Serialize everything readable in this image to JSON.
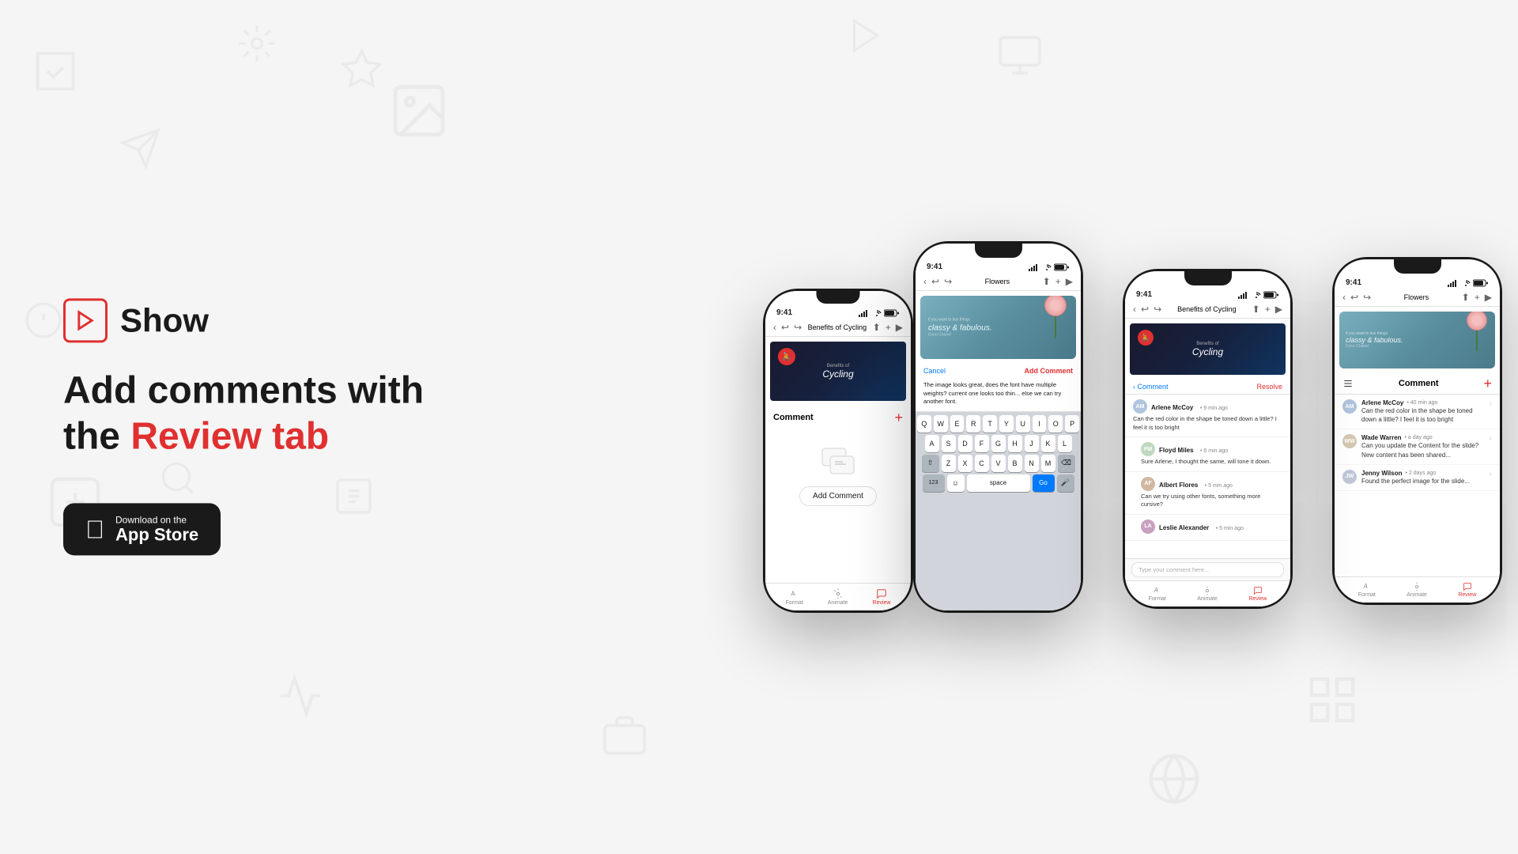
{
  "brand": {
    "name": "Show",
    "tagline": "Add comments with the",
    "highlight": "Review tab"
  },
  "app_store": {
    "label_small": "Download on the",
    "label_large": "App Store"
  },
  "phone1": {
    "status_time": "9:41",
    "doc_title": "Benefits of Cycling",
    "tab_format": "Format",
    "tab_animate": "Animate",
    "tab_review": "Review",
    "comment_header": "Comment",
    "add_comment_btn": "Add Comment"
  },
  "phone2": {
    "status_time": "9:41",
    "doc_title": "Flowers",
    "cancel_label": "Cancel",
    "add_comment_label": "Add Comment",
    "comment_text": "The image looks great, does the font have multiple weights? current one looks too thin... else we can try another font.",
    "keyboard_row1": [
      "Q",
      "W",
      "E",
      "R",
      "T",
      "Y",
      "U",
      "I",
      "O",
      "P"
    ],
    "keyboard_row2": [
      "A",
      "S",
      "D",
      "F",
      "G",
      "H",
      "J",
      "K",
      "L"
    ],
    "keyboard_row3": [
      "Z",
      "X",
      "C",
      "V",
      "B",
      "N",
      "M"
    ],
    "keyboard_bottom": [
      "123",
      "space",
      "Go"
    ]
  },
  "phone3": {
    "status_time": "9:41",
    "doc_title": "Benefits of Cycling",
    "back_label": "Comment",
    "resolve_label": "Resolve",
    "tab_format": "Format",
    "tab_animate": "Animate",
    "tab_review": "Review",
    "comments": [
      {
        "author": "Arlene McCoy",
        "time": "9 min ago",
        "avatar_color": "#b0c4de",
        "avatar_initials": "AM",
        "text": "Can the red color in the shape be toned down a little? I feel it is too bright"
      },
      {
        "author": "Floyd Miles",
        "time": "6 min ago",
        "avatar_color": "#c0d8c0",
        "avatar_initials": "FM",
        "text": "Sure Arlene, I thought the same, will tone it down."
      },
      {
        "author": "Albert Flores",
        "time": "5 min ago",
        "avatar_color": "#d0b8a0",
        "avatar_initials": "AF",
        "text": "Can we try using other fonts, something more cursive?"
      },
      {
        "author": "Leslie Alexander",
        "time": "5 min ago",
        "avatar_color": "#c8a0c0",
        "avatar_initials": "LA",
        "text": ""
      }
    ],
    "type_placeholder": "Type your comment here..."
  },
  "phone4": {
    "status_time": "9:41",
    "doc_title": "Flowers",
    "tab_format": "Format",
    "tab_animate": "Animate",
    "tab_review": "Review",
    "comment_header": "Comment",
    "comments": [
      {
        "author": "Arlene McCoy",
        "time": "40 min ago",
        "avatar_color": "#b0c4de",
        "avatar_initials": "AM",
        "text": "Can the red color in the shape be toned down a little? I feel it is too bright"
      },
      {
        "author": "Wade Warren",
        "time": "a day ago",
        "avatar_color": "#d4c8b0",
        "avatar_initials": "WW",
        "text": "Can you update the Content for the slide? New content has been shared..."
      },
      {
        "author": "Jenny Wilson",
        "time": "2 days ago",
        "avatar_color": "#c0c8d8",
        "avatar_initials": "JW",
        "text": "Found the perfect image for the slide..."
      }
    ]
  }
}
